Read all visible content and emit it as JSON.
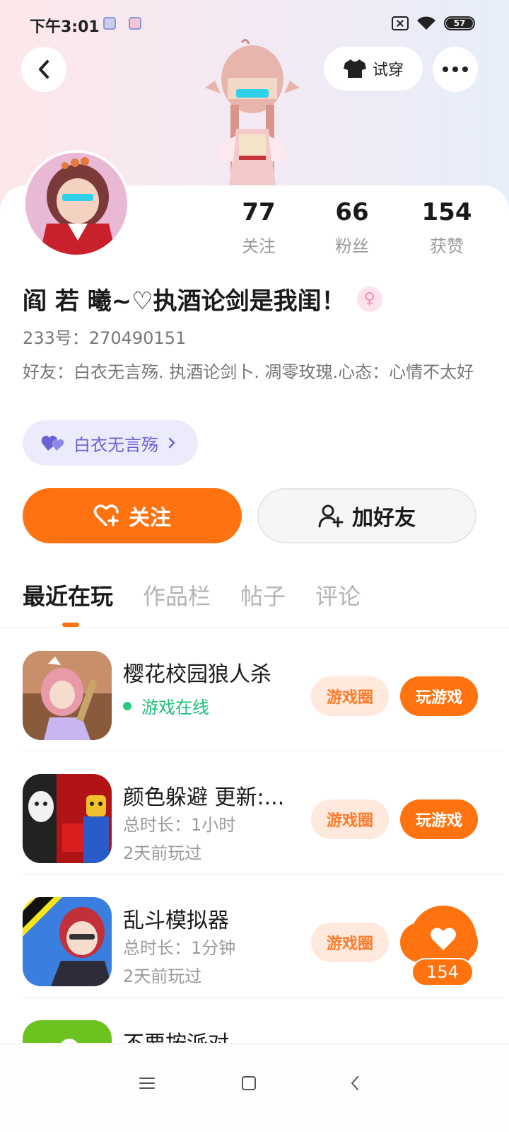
{
  "status_bar": {
    "time": "下午3:01",
    "battery": "57"
  },
  "header": {
    "try_on_label": "试穿"
  },
  "stats": [
    {
      "value": "77",
      "label": "关注"
    },
    {
      "value": "66",
      "label": "粉丝"
    },
    {
      "value": "154",
      "label": "获赞"
    }
  ],
  "profile": {
    "name": "阎 若 曦~♡执酒论剑是我闺！",
    "uid": "233号：270490151",
    "bio": "好友：白衣无言殇. 执酒论剑卜. 凋零玫瑰.心态：心情不太好",
    "friend_chip": "白衣无言殇"
  },
  "actions": {
    "follow": "关注",
    "add_friend": "加好友"
  },
  "tabs": [
    {
      "label": "最近在玩",
      "active": true
    },
    {
      "label": "作品栏",
      "active": false
    },
    {
      "label": "帖子",
      "active": false
    },
    {
      "label": "评论",
      "active": false
    }
  ],
  "games": [
    {
      "title": "樱花校园狼人杀",
      "line1": "游戏在线",
      "line2": "",
      "online": true,
      "circle_label": "游戏圈",
      "play_label": "玩游戏"
    },
    {
      "title": "颜色躲避 更新:...",
      "line1": "总时长：1小时",
      "line2": "2天前玩过",
      "online": false,
      "circle_label": "游戏圈",
      "play_label": "玩游戏"
    },
    {
      "title": "乱斗模拟器",
      "line1": "总时长：1分钟",
      "line2": "2天前玩过",
      "online": false,
      "circle_label": "游戏圈",
      "play_label": "玩游戏"
    },
    {
      "title": "不要按派对",
      "line1": "",
      "line2": "",
      "online": false,
      "circle_label": "",
      "play_label": ""
    }
  ],
  "like_fab": {
    "count": "154"
  },
  "colors": {
    "accent": "#ff7210",
    "online": "#1fbf7a",
    "chip": "#6a63d6"
  }
}
